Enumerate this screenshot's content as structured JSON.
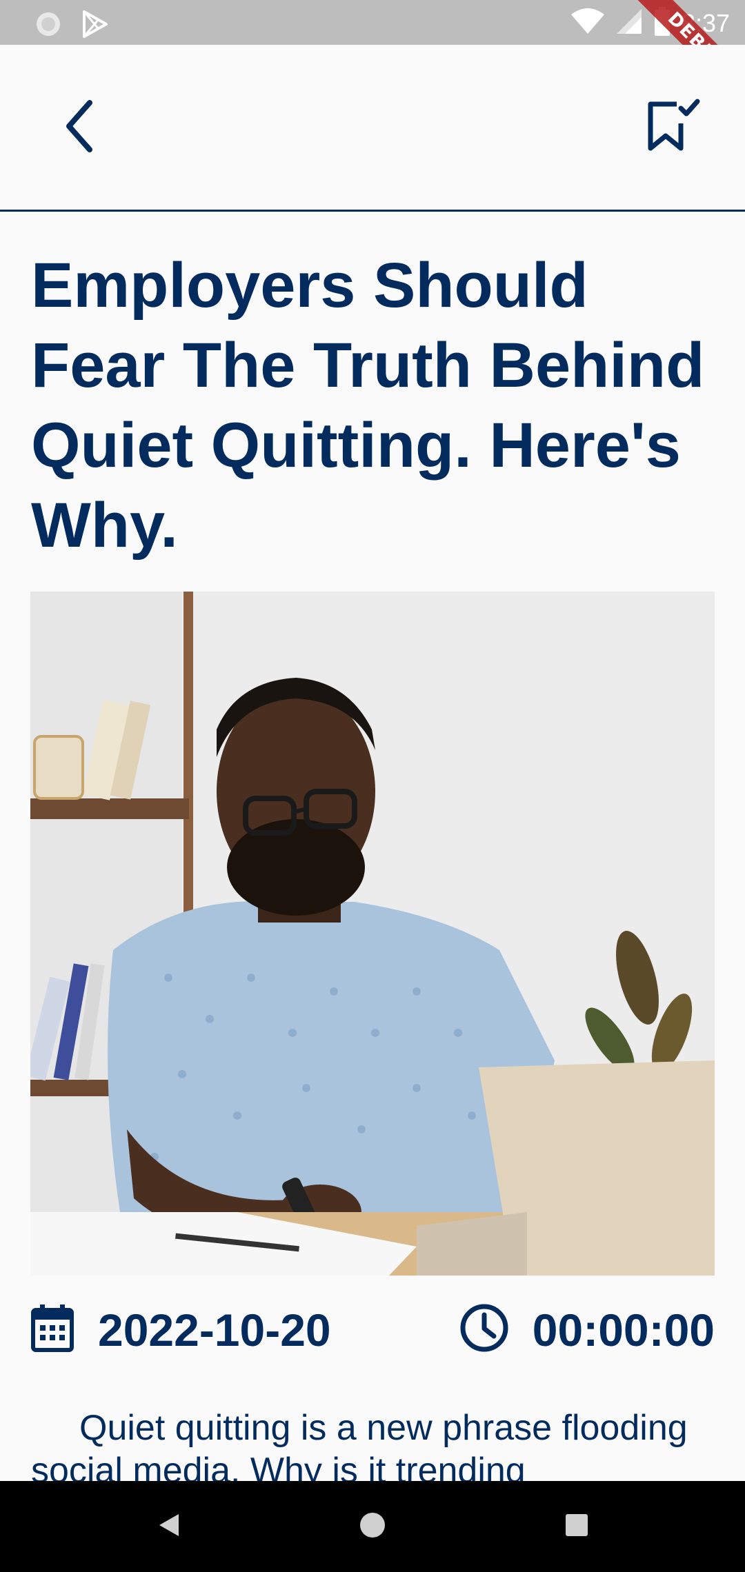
{
  "status_bar": {
    "time": "8:37",
    "debug_label": "DEBUG"
  },
  "app_bar": {
    "back_icon": "chevron-left-icon",
    "bookmark_icon": "bookmark-check-icon"
  },
  "article": {
    "title": "Employers Should Fear The Truth Behind Quiet Quitting. Here's Why.",
    "date": "2022-10-20",
    "time": "00:00:00",
    "body": "Quiet quitting is a new phrase flooding social media. Why is it trending"
  },
  "colors": {
    "primary": "#032b5e",
    "background": "#fafafa",
    "status_bar": "#bdbdbd",
    "nav_bar": "#000000",
    "debug_ribbon": "#b71c1c"
  }
}
